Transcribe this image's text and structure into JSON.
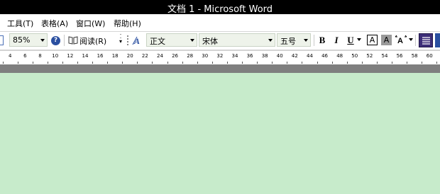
{
  "window": {
    "title": "文档 1 - Microsoft Word"
  },
  "menu": {
    "items": [
      "工具(T)",
      "表格(A)",
      "窗口(W)",
      "帮助(H)"
    ]
  },
  "toolbar": {
    "zoom": "85%",
    "read_label": "阅读(R)",
    "style": "正文",
    "font": "宋体",
    "size": "五号",
    "bold": "B",
    "italic": "I",
    "underline": "U",
    "char_border": "A",
    "char_shading": "A"
  },
  "ruler": {
    "labels": [
      "4",
      "6",
      "8",
      "10",
      "12",
      "14",
      "16",
      "18",
      "20",
      "22",
      "24",
      "26",
      "28",
      "30",
      "32",
      "34",
      "36",
      "38",
      "40",
      "42",
      "44",
      "46",
      "48",
      "50",
      "52",
      "54",
      "56",
      "58",
      "60"
    ]
  },
  "colors": {
    "document_bg": "#c7ebcb",
    "title_bg": "#000000",
    "grey_band": "#7f7f7f",
    "accent": "#2a4fa0"
  }
}
